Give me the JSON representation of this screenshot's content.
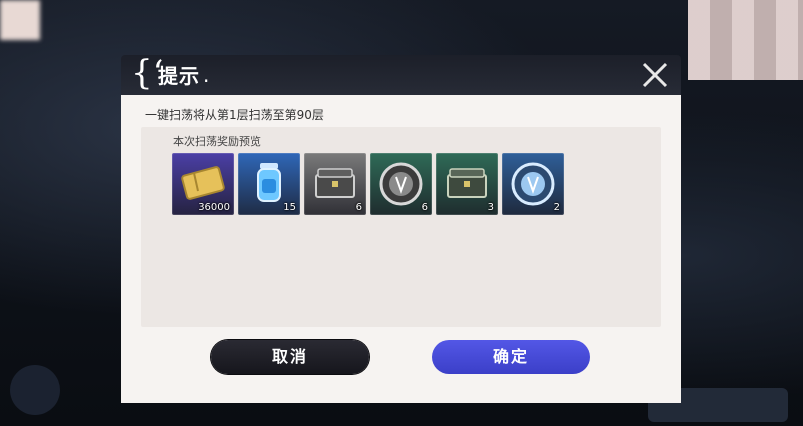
{
  "dialog": {
    "title": "提示",
    "description": "一键扫荡将从第1层扫荡至第90层",
    "rewards_label": "本次扫荡奖励预览",
    "rewards": [
      {
        "icon": "gold-ticket-icon",
        "qty": "36000",
        "bg": "#4b3fa6"
      },
      {
        "icon": "energy-potion-icon",
        "qty": "15",
        "bg": "#2f67b8"
      },
      {
        "icon": "gray-chest-icon",
        "qty": "6",
        "bg": "#7a7a7a"
      },
      {
        "icon": "silver-medal-icon",
        "qty": "6",
        "bg": "#2f6b57"
      },
      {
        "icon": "green-chest-icon",
        "qty": "3",
        "bg": "#2f6b57"
      },
      {
        "icon": "blue-medal-icon",
        "qty": "2",
        "bg": "#2f5f99"
      }
    ],
    "cancel_label": "取消",
    "confirm_label": "确定"
  },
  "colors": {
    "confirm_button": "#4a4ee0",
    "cancel_button": "#1f1f27",
    "dialog_body": "#f6f3f1"
  }
}
